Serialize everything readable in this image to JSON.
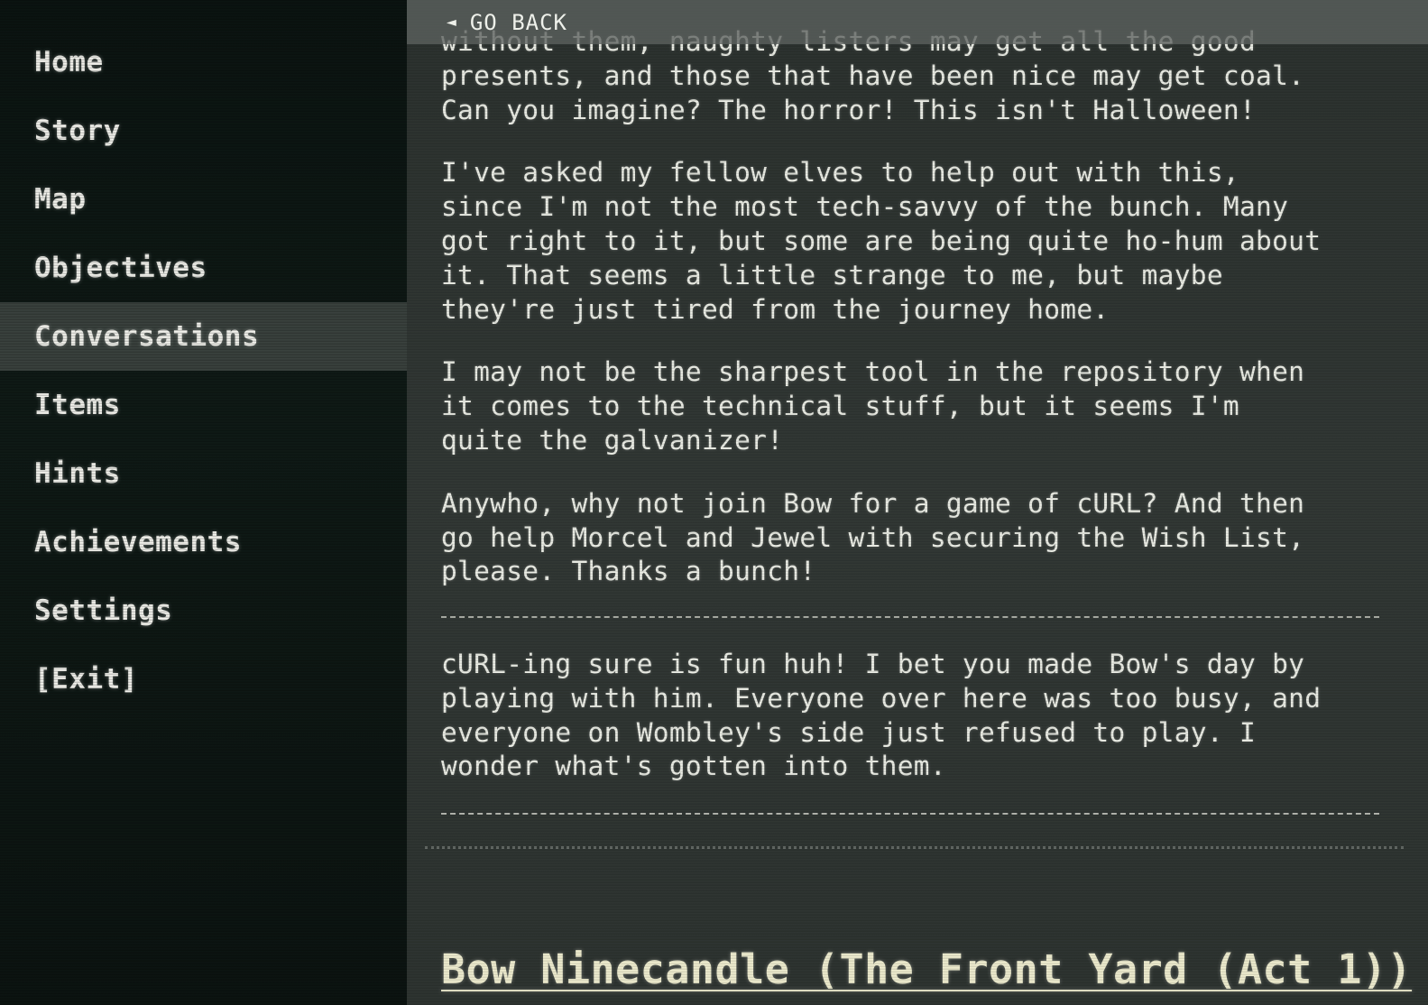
{
  "sidebar": {
    "items": [
      {
        "label": "Home",
        "active": false
      },
      {
        "label": "Story",
        "active": false
      },
      {
        "label": "Map",
        "active": false
      },
      {
        "label": "Objectives",
        "active": false
      },
      {
        "label": "Conversations",
        "active": true
      },
      {
        "label": "Items",
        "active": false
      },
      {
        "label": "Hints",
        "active": false
      },
      {
        "label": "Achievements",
        "active": false
      },
      {
        "label": "Settings",
        "active": false
      },
      {
        "label": "[Exit]",
        "active": false
      }
    ]
  },
  "back_bar": {
    "label": "GO BACK"
  },
  "conversation": {
    "partial_top": "without them, naughty listers may get all the good",
    "paragraphs": [
      "presents, and those that have been nice may get coal.\nCan you imagine? The horror! This isn't Halloween!",
      "I've asked my fellow elves to help out with this,\nsince I'm not the most tech-savvy of the bunch. Many\ngot right to it, but some are being quite ho-hum about\nit. That seems a little strange to me, but maybe\nthey're just tired from the journey home.",
      "I may not be the sharpest tool in the repository when\nit comes to the technical stuff, but it seems I'm\nquite the galvanizer!",
      "Anywho, why not join Bow for a game of cURL? And then\ngo help Morcel and Jewel with securing the Wish List,\nplease. Thanks a bunch!"
    ],
    "followup": "cURL-ing sure is fun huh! I bet you made Bow's day by\nplaying with him. Everyone over here was too busy, and\neveryone on Wombley's side just refused to play. I\nwonder what's gotten into them.",
    "next_heading": "Bow Ninecandle (The Front Yard (Act 1))"
  }
}
